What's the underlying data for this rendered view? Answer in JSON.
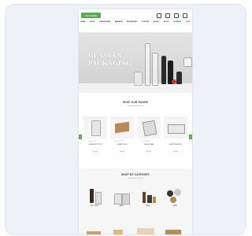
{
  "site": {
    "logo_text": "GLASVEN",
    "nav": [
      "HOME",
      "SHOP",
      "CATEGORIES",
      "BRANDS",
      "PACKAGING",
      "CUSTOM",
      "ABOUT",
      "BLOG",
      "CONTACT",
      "SALE"
    ]
  },
  "hero": {
    "title": "GLASVEN PACKAGING"
  },
  "sections": {
    "products_title": "SHOP OUR RANGE",
    "categories_title": "SHOP BY CATEGORY"
  },
  "products": [
    {
      "name": "GLASS BOTTLE",
      "price": "$1.20",
      "stars": "★★★★★"
    },
    {
      "name": "KRAFT BOX",
      "price": "$0.80",
      "stars": "★★★★★"
    },
    {
      "name": "GLASS JAR",
      "price": "$1.50",
      "stars": "★★★★★"
    },
    {
      "name": "SHIPPING BOX",
      "price": "$0.95",
      "stars": ""
    }
  ],
  "categories": [
    {
      "label": "BOTTLES"
    },
    {
      "label": "JARS"
    },
    {
      "label": "VIALS"
    },
    {
      "label": "CAPS"
    }
  ],
  "colors": {
    "brand": "#5aa84f",
    "sale": "#d33333",
    "stars": "#f2b01e"
  }
}
